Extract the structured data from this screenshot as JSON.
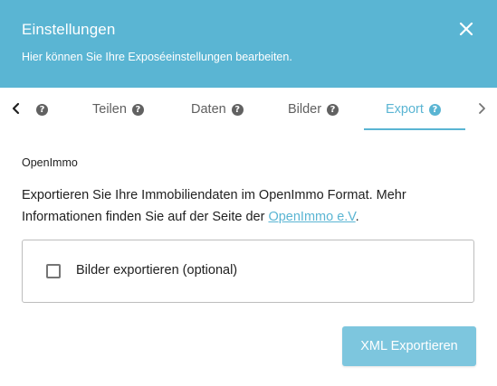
{
  "header": {
    "title": "Einstellungen",
    "subtitle": "Hier können Sie Ihre Exposéeinstellungen bearbeiten."
  },
  "tabs": [
    {
      "label": "",
      "has_help": true
    },
    {
      "label": "Teilen",
      "has_help": true
    },
    {
      "label": "Daten",
      "has_help": true
    },
    {
      "label": "Bilder",
      "has_help": true
    },
    {
      "label": "Export",
      "has_help": true,
      "active": true
    }
  ],
  "help_glyph": "?",
  "content": {
    "section_label": "OpenImmo",
    "description_before_link": "Exportieren Sie Ihre Immobiliendaten im OpenImmo Format. Mehr Informationen finden Sie auf der Seite der ",
    "link_text": "OpenImmo e.V",
    "description_after_link": ".",
    "checkbox_label": "Bilder exportieren (optional)",
    "checkbox_checked": false
  },
  "actions": {
    "export_label": "XML Exportieren"
  },
  "colors": {
    "accent": "#5ab5d3",
    "button": "#7dc6de",
    "text": "#212121",
    "muted": "#5f5f5f"
  }
}
